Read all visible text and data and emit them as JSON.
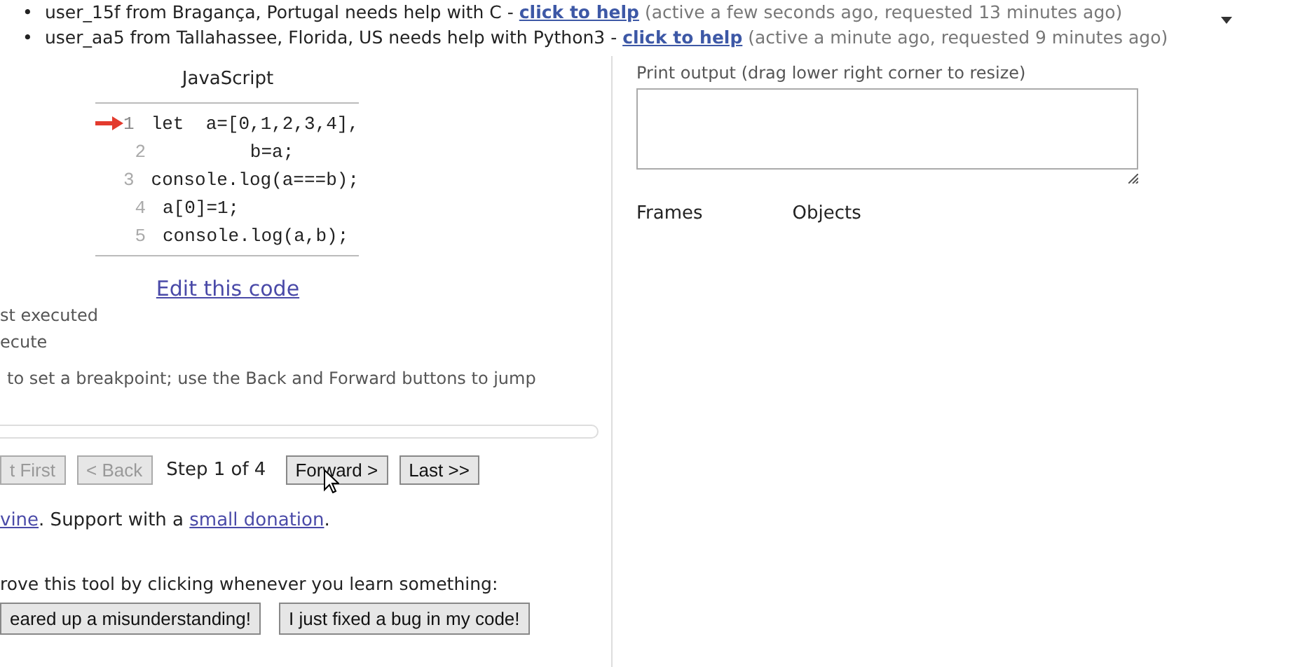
{
  "help_requests": [
    {
      "marker": "•",
      "user_text": "user_15f from Bragança, Portugal needs help with C -",
      "link": "click to help",
      "activity": "(active a few seconds ago, requested 13 minutes ago)"
    },
    {
      "marker": "•",
      "user_text": "user_aa5 from Tallahassee, Florida, US needs help with Python3 -",
      "link": "click to help",
      "activity": "(active a minute ago, requested 9 minutes ago)"
    }
  ],
  "code": {
    "language": "JavaScript",
    "lines": [
      {
        "number": "1",
        "text": "let  a=[0,1,2,3,4],",
        "current": true
      },
      {
        "number": "2",
        "text": "        b=a;",
        "current": false
      },
      {
        "number": "3",
        "text": "console.log(a===b);",
        "current": false
      },
      {
        "number": "4",
        "text": "a[0]=1;",
        "current": false
      },
      {
        "number": "5",
        "text": "console.log(a,b);",
        "current": false
      }
    ]
  },
  "edit_link": "Edit this code",
  "legend": [
    "st executed",
    "ecute"
  ],
  "hint": "to set a breakpoint; use the Back and Forward buttons to jump",
  "slider": {
    "level": 0
  },
  "navigation": {
    "buttons": [
      {
        "label": "t First",
        "disabled": true
      },
      {
        "label": "< Back",
        "disabled": true
      },
      {
        "label": "Forward >",
        "disabled": false
      },
      {
        "label": "Last >>",
        "disabled": false
      }
    ],
    "step": "Step 1 of 4"
  },
  "credit": {
    "author_link": "vine",
    "text": ". Support with a",
    "donation_link": "small donation",
    "end": "."
  },
  "feedback": {
    "prompt": "rove this tool by clicking whenever you learn something:",
    "buttons": [
      "eared up a misunderstanding!",
      "I just fixed a bug in my code!"
    ]
  },
  "output": {
    "label": "Print output (drag lower right corner to resize)"
  },
  "frames_heading": "Frames",
  "objects_heading": "Objects"
}
